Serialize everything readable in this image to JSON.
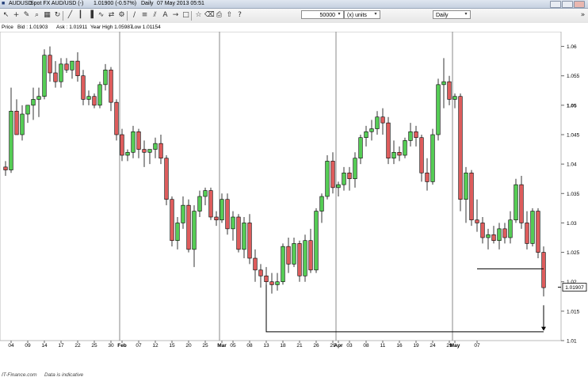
{
  "window": {
    "title_symbol": "AUDUSD",
    "title_instrument": "Spot FX AUD/USD (-)",
    "title_price": "1.01900 (-0.57%)",
    "title_period": "Daily",
    "title_timestamp": "07 May 2013 05:51"
  },
  "toolbar": {
    "icons": [
      "cursor-icon",
      "crosshair-icon",
      "pencil-icon",
      "zoom-icon",
      "grid-icon",
      "refresh-icon",
      "line-chart-icon",
      "candlestick-icon",
      "bar-chart-icon",
      "indicator-icon",
      "compare-icon",
      "settings-icon",
      "trendline-icon",
      "fibonacci-icon",
      "channel-icon",
      "text-icon",
      "arrow-icon",
      "shapes-icon",
      "star-icon",
      "eraser-icon",
      "print-icon",
      "export-icon",
      "help-icon"
    ],
    "quantity_value": "50000",
    "units_value": "(x) units",
    "period_value": "Daily"
  },
  "infobar": {
    "label": "Price",
    "bid": "Bid : 1.01903",
    "ask": "Ask : 1.01911",
    "year_high": "Year High 1.05987",
    "low": "Low 1.01154"
  },
  "colors": {
    "up": "#55cc55",
    "down": "#dd5c5c",
    "price_marker": "#000000"
  },
  "footer": {
    "watermark": "IT-Finance.com",
    "note": "Data is indicative"
  },
  "chart_data": {
    "type": "candlestick",
    "title": "Spot FX AUD/USD (-)",
    "ylim": [
      1.01,
      1.0625
    ],
    "y_ticks": [
      "1.01",
      "1.015",
      "1.02",
      "1.025",
      "1.03",
      "1.035",
      "1.04",
      "1.045",
      "1.05",
      "1.055",
      "1.06"
    ],
    "y_tick_values": [
      1.01,
      1.015,
      1.02,
      1.025,
      1.03,
      1.035,
      1.04,
      1.045,
      1.05,
      1.055,
      1.06
    ],
    "y_bold_tick": "1.05",
    "current_price_label": "1.01907",
    "current_price": 1.01907,
    "x_labels": [
      {
        "t": "04",
        "i": 1
      },
      {
        "t": "09",
        "i": 4
      },
      {
        "t": "14",
        "i": 7
      },
      {
        "t": "17",
        "i": 10
      },
      {
        "t": "22",
        "i": 13
      },
      {
        "t": "25",
        "i": 16
      },
      {
        "t": "30",
        "i": 19
      },
      {
        "t": "Feb",
        "i": 21,
        "bold": true
      },
      {
        "t": "07",
        "i": 24
      },
      {
        "t": "12",
        "i": 27
      },
      {
        "t": "15",
        "i": 30
      },
      {
        "t": "20",
        "i": 33
      },
      {
        "t": "25",
        "i": 36
      },
      {
        "t": "Mar",
        "i": 39,
        "bold": true
      },
      {
        "t": "05",
        "i": 41
      },
      {
        "t": "08",
        "i": 44
      },
      {
        "t": "13",
        "i": 47
      },
      {
        "t": "18",
        "i": 50
      },
      {
        "t": "21",
        "i": 53
      },
      {
        "t": "26",
        "i": 56
      },
      {
        "t": "29",
        "i": 59
      },
      {
        "t": "Apr",
        "i": 60,
        "bold": true
      },
      {
        "t": "03",
        "i": 62
      },
      {
        "t": "08",
        "i": 65
      },
      {
        "t": "11",
        "i": 68
      },
      {
        "t": "16",
        "i": 71
      },
      {
        "t": "19",
        "i": 74
      },
      {
        "t": "24",
        "i": 77
      },
      {
        "t": "29",
        "i": 80
      },
      {
        "t": "May",
        "i": 81,
        "bold": true
      },
      {
        "t": "07",
        "i": 85
      }
    ],
    "month_separators": [
      21,
      39,
      60,
      81
    ],
    "candles": [
      {
        "o": 1.0395,
        "h": 1.0405,
        "l": 1.038,
        "c": 1.039
      },
      {
        "o": 1.039,
        "h": 1.053,
        "l": 1.0385,
        "c": 1.049
      },
      {
        "o": 1.049,
        "h": 1.051,
        "l": 1.046,
        "c": 1.045
      },
      {
        "o": 1.045,
        "h": 1.05,
        "l": 1.044,
        "c": 1.0485
      },
      {
        "o": 1.0485,
        "h": 1.05,
        "l": 1.047,
        "c": 1.05
      },
      {
        "o": 1.05,
        "h": 1.053,
        "l": 1.0475,
        "c": 1.051
      },
      {
        "o": 1.051,
        "h": 1.053,
        "l": 1.048,
        "c": 1.0515
      },
      {
        "o": 1.0515,
        "h": 1.0595,
        "l": 1.051,
        "c": 1.0585
      },
      {
        "o": 1.0585,
        "h": 1.06,
        "l": 1.054,
        "c": 1.0555
      },
      {
        "o": 1.0555,
        "h": 1.0575,
        "l": 1.053,
        "c": 1.054
      },
      {
        "o": 1.054,
        "h": 1.058,
        "l": 1.053,
        "c": 1.057
      },
      {
        "o": 1.057,
        "h": 1.058,
        "l": 1.0555,
        "c": 1.056
      },
      {
        "o": 1.056,
        "h": 1.0575,
        "l": 1.0545,
        "c": 1.0575
      },
      {
        "o": 1.0575,
        "h": 1.059,
        "l": 1.054,
        "c": 1.055
      },
      {
        "o": 1.055,
        "h": 1.056,
        "l": 1.05,
        "c": 1.051
      },
      {
        "o": 1.051,
        "h": 1.0525,
        "l": 1.05,
        "c": 1.0515
      },
      {
        "o": 1.0515,
        "h": 1.052,
        "l": 1.0495,
        "c": 1.05
      },
      {
        "o": 1.05,
        "h": 1.054,
        "l": 1.0495,
        "c": 1.0535
      },
      {
        "o": 1.0535,
        "h": 1.057,
        "l": 1.0525,
        "c": 1.056
      },
      {
        "o": 1.056,
        "h": 1.0565,
        "l": 1.049,
        "c": 1.0505
      },
      {
        "o": 1.0505,
        "h": 1.051,
        "l": 1.044,
        "c": 1.045
      },
      {
        "o": 1.045,
        "h": 1.046,
        "l": 1.0405,
        "c": 1.0415
      },
      {
        "o": 1.0415,
        "h": 1.0425,
        "l": 1.0405,
        "c": 1.042
      },
      {
        "o": 1.042,
        "h": 1.0465,
        "l": 1.041,
        "c": 1.0455
      },
      {
        "o": 1.0455,
        "h": 1.046,
        "l": 1.041,
        "c": 1.0425
      },
      {
        "o": 1.0425,
        "h": 1.044,
        "l": 1.0395,
        "c": 1.042
      },
      {
        "o": 1.042,
        "h": 1.0425,
        "l": 1.04,
        "c": 1.0425
      },
      {
        "o": 1.0425,
        "h": 1.0445,
        "l": 1.041,
        "c": 1.0435
      },
      {
        "o": 1.0435,
        "h": 1.045,
        "l": 1.04,
        "c": 1.041
      },
      {
        "o": 1.041,
        "h": 1.0415,
        "l": 1.033,
        "c": 1.034
      },
      {
        "o": 1.034,
        "h": 1.0345,
        "l": 1.026,
        "c": 1.027
      },
      {
        "o": 1.027,
        "h": 1.031,
        "l": 1.0255,
        "c": 1.03
      },
      {
        "o": 1.03,
        "h": 1.0345,
        "l": 1.029,
        "c": 1.033
      },
      {
        "o": 1.033,
        "h": 1.034,
        "l": 1.025,
        "c": 1.0255
      },
      {
        "o": 1.0255,
        "h": 1.033,
        "l": 1.0225,
        "c": 1.032
      },
      {
        "o": 1.032,
        "h": 1.0355,
        "l": 1.031,
        "c": 1.0345
      },
      {
        "o": 1.0345,
        "h": 1.036,
        "l": 1.033,
        "c": 1.0355
      },
      {
        "o": 1.0355,
        "h": 1.036,
        "l": 1.0305,
        "c": 1.031
      },
      {
        "o": 1.031,
        "h": 1.032,
        "l": 1.0295,
        "c": 1.0305
      },
      {
        "o": 1.0305,
        "h": 1.035,
        "l": 1.03,
        "c": 1.034
      },
      {
        "o": 1.034,
        "h": 1.035,
        "l": 1.028,
        "c": 1.029
      },
      {
        "o": 1.029,
        "h": 1.032,
        "l": 1.027,
        "c": 1.031
      },
      {
        "o": 1.031,
        "h": 1.0315,
        "l": 1.025,
        "c": 1.0255
      },
      {
        "o": 1.0255,
        "h": 1.031,
        "l": 1.024,
        "c": 1.03
      },
      {
        "o": 1.03,
        "h": 1.0315,
        "l": 1.023,
        "c": 1.024
      },
      {
        "o": 1.024,
        "h": 1.0255,
        "l": 1.02,
        "c": 1.022
      },
      {
        "o": 1.022,
        "h": 1.023,
        "l": 1.019,
        "c": 1.021
      },
      {
        "o": 1.021,
        "h": 1.0225,
        "l": 1.018,
        "c": 1.02
      },
      {
        "o": 1.02,
        "h": 1.0215,
        "l": 1.018,
        "c": 1.0195
      },
      {
        "o": 1.0195,
        "h": 1.0215,
        "l": 1.0185,
        "c": 1.02
      },
      {
        "o": 1.02,
        "h": 1.0265,
        "l": 1.0195,
        "c": 1.026
      },
      {
        "o": 1.026,
        "h": 1.0275,
        "l": 1.0215,
        "c": 1.023
      },
      {
        "o": 1.023,
        "h": 1.0275,
        "l": 1.0225,
        "c": 1.0265
      },
      {
        "o": 1.0265,
        "h": 1.027,
        "l": 1.02,
        "c": 1.021
      },
      {
        "o": 1.021,
        "h": 1.028,
        "l": 1.02,
        "c": 1.027
      },
      {
        "o": 1.027,
        "h": 1.029,
        "l": 1.0215,
        "c": 1.022
      },
      {
        "o": 1.022,
        "h": 1.0325,
        "l": 1.0215,
        "c": 1.032
      },
      {
        "o": 1.032,
        "h": 1.035,
        "l": 1.03,
        "c": 1.0345
      },
      {
        "o": 1.0345,
        "h": 1.0415,
        "l": 1.034,
        "c": 1.0405
      },
      {
        "o": 1.0405,
        "h": 1.042,
        "l": 1.035,
        "c": 1.036
      },
      {
        "o": 1.036,
        "h": 1.037,
        "l": 1.0345,
        "c": 1.0365
      },
      {
        "o": 1.0365,
        "h": 1.0395,
        "l": 1.0355,
        "c": 1.0385
      },
      {
        "o": 1.0385,
        "h": 1.0395,
        "l": 1.0355,
        "c": 1.0375
      },
      {
        "o": 1.0375,
        "h": 1.042,
        "l": 1.036,
        "c": 1.041
      },
      {
        "o": 1.041,
        "h": 1.045,
        "l": 1.04,
        "c": 1.0445
      },
      {
        "o": 1.0445,
        "h": 1.0465,
        "l": 1.043,
        "c": 1.0455
      },
      {
        "o": 1.0455,
        "h": 1.0475,
        "l": 1.044,
        "c": 1.046
      },
      {
        "o": 1.046,
        "h": 1.049,
        "l": 1.045,
        "c": 1.048
      },
      {
        "o": 1.048,
        "h": 1.0495,
        "l": 1.045,
        "c": 1.047
      },
      {
        "o": 1.047,
        "h": 1.048,
        "l": 1.04,
        "c": 1.041
      },
      {
        "o": 1.041,
        "h": 1.044,
        "l": 1.04,
        "c": 1.042
      },
      {
        "o": 1.042,
        "h": 1.043,
        "l": 1.0405,
        "c": 1.0415
      },
      {
        "o": 1.0415,
        "h": 1.0445,
        "l": 1.041,
        "c": 1.044
      },
      {
        "o": 1.044,
        "h": 1.047,
        "l": 1.043,
        "c": 1.0455
      },
      {
        "o": 1.0455,
        "h": 1.0465,
        "l": 1.043,
        "c": 1.0445
      },
      {
        "o": 1.0445,
        "h": 1.045,
        "l": 1.037,
        "c": 1.0385
      },
      {
        "o": 1.0385,
        "h": 1.041,
        "l": 1.0355,
        "c": 1.037
      },
      {
        "o": 1.037,
        "h": 1.046,
        "l": 1.0365,
        "c": 1.045
      },
      {
        "o": 1.045,
        "h": 1.0545,
        "l": 1.044,
        "c": 1.0535
      },
      {
        "o": 1.0535,
        "h": 1.058,
        "l": 1.0495,
        "c": 1.054
      },
      {
        "o": 1.054,
        "h": 1.055,
        "l": 1.05,
        "c": 1.051
      },
      {
        "o": 1.051,
        "h": 1.052,
        "l": 1.0495,
        "c": 1.0515
      },
      {
        "o": 1.0515,
        "h": 1.052,
        "l": 1.032,
        "c": 1.034
      },
      {
        "o": 1.034,
        "h": 1.0395,
        "l": 1.03,
        "c": 1.0385
      },
      {
        "o": 1.0385,
        "h": 1.039,
        "l": 1.0295,
        "c": 1.0305
      },
      {
        "o": 1.0305,
        "h": 1.034,
        "l": 1.0285,
        "c": 1.03
      },
      {
        "o": 1.03,
        "h": 1.031,
        "l": 1.0265,
        "c": 1.0275
      },
      {
        "o": 1.0275,
        "h": 1.029,
        "l": 1.0255,
        "c": 1.028
      },
      {
        "o": 1.028,
        "h": 1.0295,
        "l": 1.0265,
        "c": 1.027
      },
      {
        "o": 1.027,
        "h": 1.03,
        "l": 1.0255,
        "c": 1.029
      },
      {
        "o": 1.029,
        "h": 1.03,
        "l": 1.0265,
        "c": 1.0275
      },
      {
        "o": 1.0275,
        "h": 1.032,
        "l": 1.0265,
        "c": 1.0305
      },
      {
        "o": 1.0305,
        "h": 1.0375,
        "l": 1.03,
        "c": 1.0365
      },
      {
        "o": 1.0365,
        "h": 1.038,
        "l": 1.029,
        "c": 1.03
      },
      {
        "o": 1.03,
        "h": 1.032,
        "l": 1.0255,
        "c": 1.0265
      },
      {
        "o": 1.0265,
        "h": 1.0325,
        "l": 1.026,
        "c": 1.032
      },
      {
        "o": 1.032,
        "h": 1.0325,
        "l": 1.024,
        "c": 1.025
      },
      {
        "o": 1.025,
        "h": 1.026,
        "l": 1.0175,
        "c": 1.019
      }
    ],
    "annotations": [
      {
        "type": "hline",
        "y": 1.0222,
        "from": 85,
        "to": 97
      },
      {
        "type": "polyline",
        "points": [
          [
            47,
            1.0195
          ],
          [
            47,
            1.0115
          ],
          [
            97,
            1.0115
          ]
        ]
      },
      {
        "type": "arrow",
        "x": 97,
        "y_from": 1.016,
        "y_to": 1.0118
      }
    ]
  }
}
